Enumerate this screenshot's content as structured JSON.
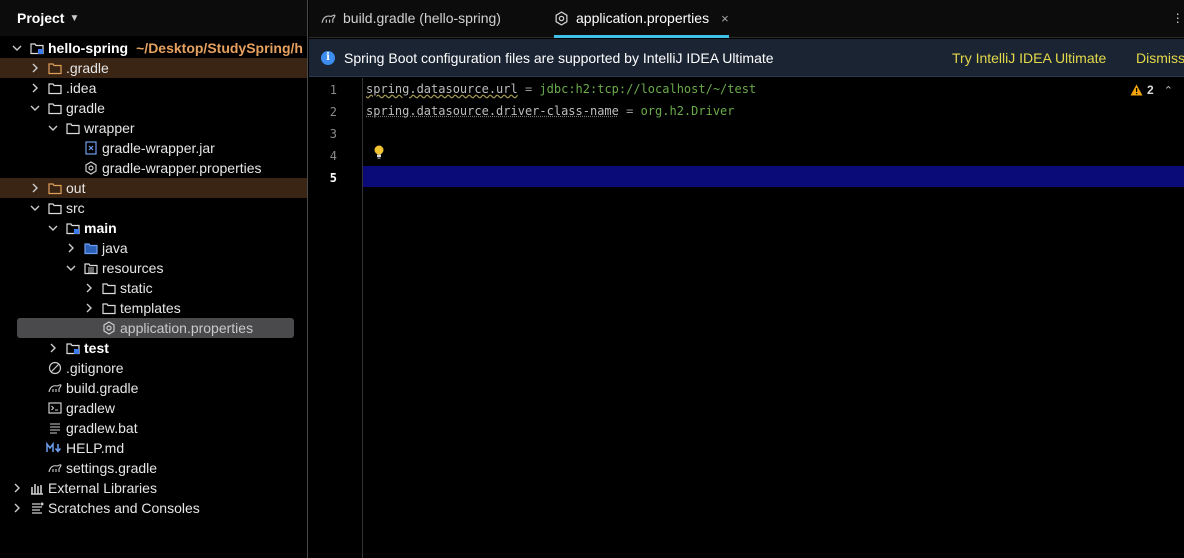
{
  "project_panel": {
    "title": "Project",
    "root": {
      "name": "hello-spring",
      "path": "~/Desktop/StudySpring/h"
    },
    "items": [
      {
        "label": ".gradle"
      },
      {
        "label": ".idea"
      },
      {
        "label": "gradle"
      },
      {
        "label": "wrapper"
      },
      {
        "label": "gradle-wrapper.jar"
      },
      {
        "label": "gradle-wrapper.properties"
      },
      {
        "label": "out"
      },
      {
        "label": "src"
      },
      {
        "label": "main"
      },
      {
        "label": "java"
      },
      {
        "label": "resources"
      },
      {
        "label": "static"
      },
      {
        "label": "templates"
      },
      {
        "label": "application.properties"
      },
      {
        "label": "test"
      },
      {
        "label": ".gitignore"
      },
      {
        "label": "build.gradle"
      },
      {
        "label": "gradlew"
      },
      {
        "label": "gradlew.bat"
      },
      {
        "label": "HELP.md"
      },
      {
        "label": "settings.gradle"
      },
      {
        "label": "External Libraries"
      },
      {
        "label": "Scratches and Consoles"
      }
    ]
  },
  "tabs": [
    {
      "label": "build.gradle (hello-spring)"
    },
    {
      "label": "application.properties",
      "close": "×"
    }
  ],
  "banner": {
    "message": "Spring Boot configuration files are supported by IntelliJ IDEA Ultimate",
    "action_try": "Try IntelliJ IDEA Ultimate",
    "action_dismiss": "Dismiss"
  },
  "editor": {
    "line_numbers": [
      "1",
      "2",
      "3",
      "4",
      "5"
    ],
    "lines": [
      {
        "key": "spring.datasource.url",
        "eq": "=",
        "value": "jdbc:h2:tcp://localhost/~/test"
      },
      {
        "key": "spring.datasource.driver-class-name",
        "eq": "=",
        "value": "org.h2.Driver"
      }
    ],
    "warnings_count": "2"
  },
  "colors": {
    "accent_tab": "#3fc1e8",
    "current_line": "#0a0a78",
    "excluded_folder_bg": "#3a2413",
    "banner_link": "#e4d94a",
    "string_value": "#6aab4a"
  }
}
